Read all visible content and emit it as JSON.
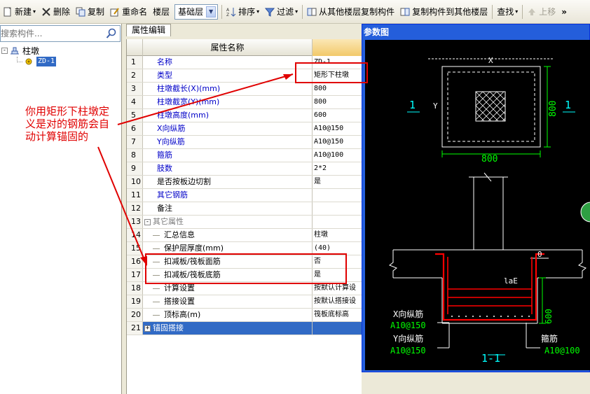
{
  "toolbar": {
    "new_label": "新建",
    "delete_label": "删除",
    "copy_label": "复制",
    "rename_label": "重命名",
    "floor_label": "楼层",
    "floor_value": "基础层",
    "sort_label": "排序",
    "filter_label": "过滤",
    "copy_from_label": "从其他楼层复制构件",
    "copy_to_label": "复制构件到其他楼层",
    "find_label": "查找",
    "up_label": "上移",
    "more_label": "»"
  },
  "left_panel": {
    "search_placeholder": "搜索构件...",
    "tree_root": "柱墩",
    "tree_child": "ZD-1"
  },
  "tab": {
    "label": "属性编辑"
  },
  "grid": {
    "header_name": "属性名称",
    "rows": [
      {
        "num": "1",
        "name": "名称",
        "value": "ZD-1",
        "style": "blue"
      },
      {
        "num": "2",
        "name": "类型",
        "value": "矩形下柱墩",
        "style": "blue"
      },
      {
        "num": "3",
        "name": "柱墩截长(X)(mm)",
        "value": "800",
        "style": "blue"
      },
      {
        "num": "4",
        "name": "柱墩截宽(Y)(mm)",
        "value": "800",
        "style": "blue"
      },
      {
        "num": "5",
        "name": "柱墩高度(mm)",
        "value": "600",
        "style": "blue"
      },
      {
        "num": "6",
        "name": "X向纵筋",
        "value": "A10@150",
        "style": "blue"
      },
      {
        "num": "7",
        "name": "Y向纵筋",
        "value": "A10@150",
        "style": "blue"
      },
      {
        "num": "8",
        "name": "箍筋",
        "value": "A10@100",
        "style": "blue"
      },
      {
        "num": "9",
        "name": "肢数",
        "value": "2*2",
        "style": "blue"
      },
      {
        "num": "10",
        "name": "是否按板边切割",
        "value": "是",
        "style": "black"
      },
      {
        "num": "11",
        "name": "其它钢筋",
        "value": "",
        "style": "blue"
      },
      {
        "num": "12",
        "name": "备注",
        "value": "",
        "style": "black"
      },
      {
        "num": "13",
        "name": "其它属性",
        "value": "",
        "style": "group"
      },
      {
        "num": "14",
        "name": "汇总信息",
        "value": "柱墩",
        "style": "child"
      },
      {
        "num": "15",
        "name": "保护层厚度(mm)",
        "value": "(40)",
        "style": "child"
      },
      {
        "num": "16",
        "name": "扣减板/筏板面筋",
        "value": "否",
        "style": "child"
      },
      {
        "num": "17",
        "name": "扣减板/筏板底筋",
        "value": "是",
        "style": "child"
      },
      {
        "num": "18",
        "name": "计算设置",
        "value": "按默认计算设",
        "style": "child"
      },
      {
        "num": "19",
        "name": "搭接设置",
        "value": "按默认搭接设",
        "style": "child"
      },
      {
        "num": "20",
        "name": "顶标高(m)",
        "value": "筏板底标高",
        "style": "child"
      },
      {
        "num": "21",
        "name": "锚固搭接",
        "value": "",
        "style": "selected"
      }
    ]
  },
  "param_window": {
    "title": "参数图",
    "x_dim": "X",
    "y_dim": "Y",
    "plan_width": "800",
    "plan_height": "800",
    "section_mark": "1",
    "zero_label": "0",
    "lae_label": "laE",
    "depth_label": "600",
    "x_bar_label": "X向纵筋",
    "x_bar_value": "A10@150",
    "y_bar_label": "Y向纵筋",
    "y_bar_value": "A10@150",
    "stirrup_label": "箍筋",
    "stirrup_value": "A10@100",
    "section_title": "1-1"
  },
  "annotation": {
    "text": "你用矩形下柱墩定义是对的钢筋会自动计算锚固的"
  },
  "colors": {
    "annotation": "#e00000",
    "cad_white": "#ffffff",
    "cad_cyan": "#00ffff",
    "cad_red": "#ff0000",
    "cad_green": "#00ff00",
    "selection": "#316ac5",
    "title_bar": "#245edb"
  }
}
